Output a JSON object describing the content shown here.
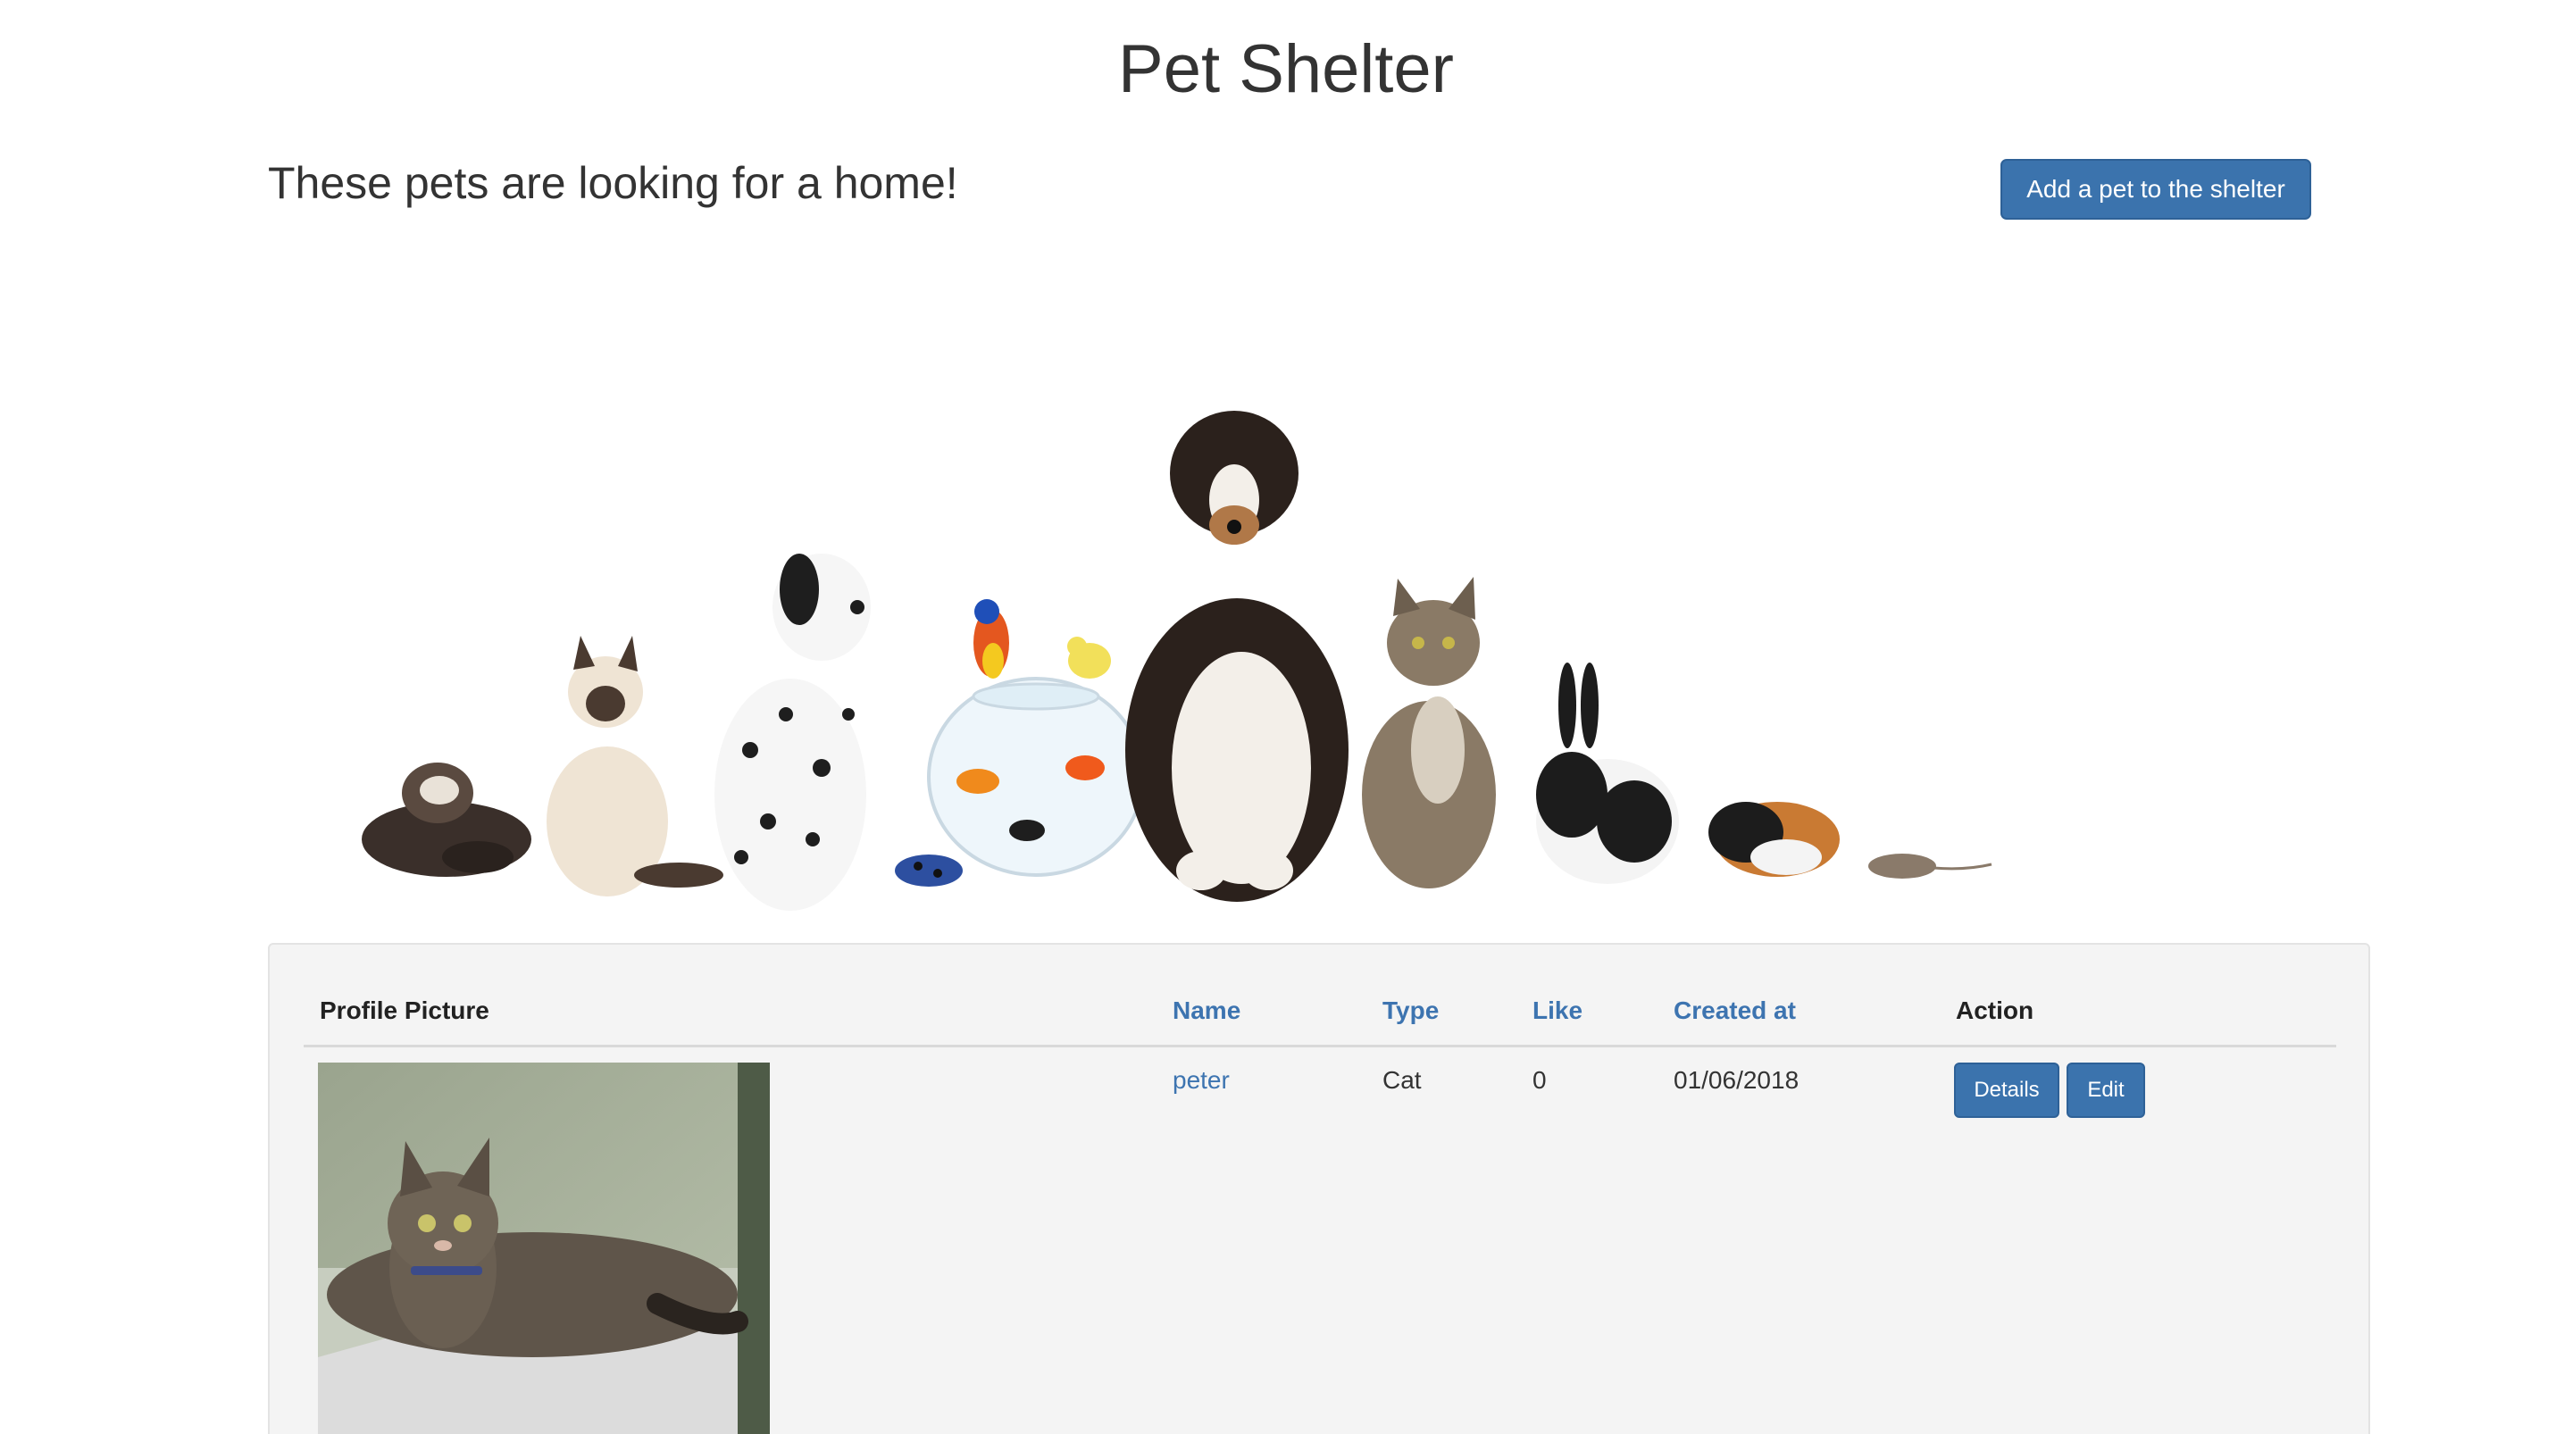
{
  "header": {
    "title": "Pet Shelter",
    "subtitle": "These pets are looking for a home!",
    "add_button_label": "Add a pet to the shelter"
  },
  "banner": {
    "image": "pets-lineup-illustration"
  },
  "table": {
    "columns": {
      "profile_picture": "Profile Picture",
      "name": "Name",
      "type": "Type",
      "like": "Like",
      "created_at": "Created at",
      "action": "Action"
    },
    "rows": [
      {
        "profile_picture": "tabby-cat-photo",
        "name": "peter",
        "type": "Cat",
        "like": "0",
        "created_at": "01/06/2018",
        "details_label": "Details",
        "edit_label": "Edit"
      }
    ]
  },
  "colors": {
    "primary": "#3b73ad",
    "link": "#3d74b0",
    "panel_bg": "#f4f4f4"
  }
}
